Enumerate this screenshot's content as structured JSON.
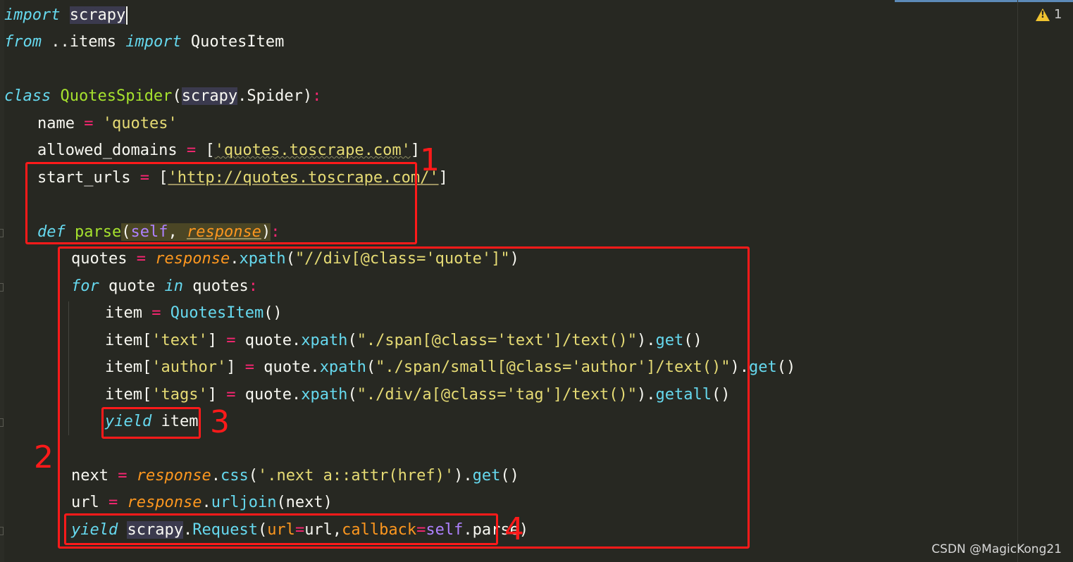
{
  "editor": {
    "warning_count": "1",
    "warning_icon": "warning-triangle-icon",
    "watermark": "CSDN @MagicKong21"
  },
  "code": {
    "l1_import": "import",
    "l1_scrapy": "scrapy",
    "l2_from": "from",
    "l2_module": " ..items ",
    "l2_import": "import",
    "l2_name": " QuotesItem",
    "l4_class": "class",
    "l4_name": "QuotesSpider",
    "l4_open": "(",
    "l4_base_mod": "scrapy",
    "l4_base_rest": ".Spider)",
    "l4_colon": ":",
    "l5_name": "name",
    "l5_eq": " = ",
    "l5_val": "'quotes'",
    "l6_name": "allowed_domains",
    "l6_eq": " = ",
    "l6_open": "[",
    "l6_val": "'quotes.toscrape.com'",
    "l6_close": "]",
    "l7_name": "start_urls",
    "l7_eq": " = ",
    "l7_open": "[",
    "l7_val": "'http://quotes.toscrape.com/'",
    "l7_close": "]",
    "l9_def": "def",
    "l9_name": " parse",
    "l9_open": "(",
    "l9_self": "self",
    "l9_comma": ", ",
    "l9_param": "response",
    "l9_close": ")",
    "l9_colon": ":",
    "l10_var": "quotes",
    "l10_eq": " = ",
    "l10_resp": "response",
    "l10_dot": ".",
    "l10_fn": "xpath",
    "l10_open": "(",
    "l10_str": "\"//div[@class='quote']\"",
    "l10_close": ")",
    "l11_for": "for",
    "l11_var": " quote ",
    "l11_in": "in",
    "l11_iter": " quotes",
    "l11_colon": ":",
    "l12_var": "item",
    "l12_eq": " = ",
    "l12_cls": "QuotesItem",
    "l12_call": "()",
    "l13_var": "item[",
    "l13_key": "'text'",
    "l13_close": "]",
    "l13_eq": " = ",
    "l13_obj": "quote.",
    "l13_fn": "xpath",
    "l13_open": "(",
    "l13_str": "\"./span[@class='text']/text()\"",
    "l13_close2": ").",
    "l13_get": "get",
    "l13_call": "()",
    "l14_var": "item[",
    "l14_key": "'author'",
    "l14_close": "]",
    "l14_eq": " = ",
    "l14_obj": "quote.",
    "l14_fn": "xpath",
    "l14_open": "(",
    "l14_str": "\"./span/small[@class='author']/text()\"",
    "l14_close2": ").",
    "l14_get": "get",
    "l14_call": "()",
    "l15_var": "item[",
    "l15_key": "'tags'",
    "l15_close": "]",
    "l15_eq": " = ",
    "l15_obj": "quote.",
    "l15_fn": "xpath",
    "l15_open": "(",
    "l15_str": "\"./div/a[@class='tag']/text()\"",
    "l15_close2": ").",
    "l15_get": "getall",
    "l15_call": "()",
    "l16_yield": "yield",
    "l16_item": " item",
    "l18_var": "next",
    "l18_eq": " = ",
    "l18_resp": "response",
    "l18_dot": ".",
    "l18_fn": "css",
    "l18_open": "(",
    "l18_str": "'.next a::attr(href)'",
    "l18_close": ").",
    "l18_get": "get",
    "l18_call": "()",
    "l19_var": "url",
    "l19_eq": " = ",
    "l19_resp": "response",
    "l19_dot": ".",
    "l19_fn": "urljoin",
    "l19_args": "(next)",
    "l20_yield": "yield",
    "l20_sp": " ",
    "l20_mod": "scrapy",
    "l20_dot": ".",
    "l20_cls": "Request",
    "l20_open": "(",
    "l20_k1": "url",
    "l20_eq1": "=",
    "l20_v1": "url,",
    "l20_k2": "callback",
    "l20_eq2": "=",
    "l20_self": "self",
    "l20_rest": ".parse)"
  },
  "annotations": {
    "box1": "1",
    "box2": "2",
    "box3": "3",
    "box4": "4"
  }
}
